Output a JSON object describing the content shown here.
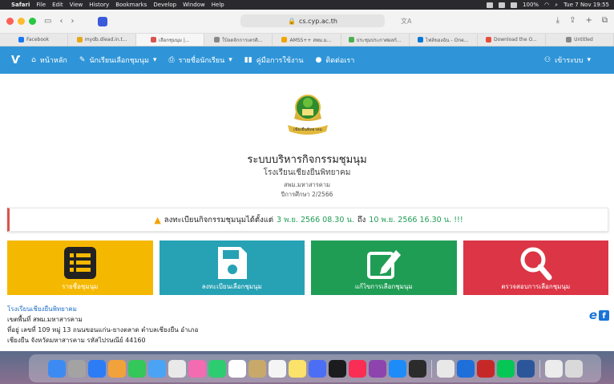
{
  "menubar": {
    "app": "Safari",
    "menus": [
      "File",
      "Edit",
      "View",
      "History",
      "Bookmarks",
      "Develop",
      "Window",
      "Help"
    ],
    "battery": "100%",
    "clock": "Tue 7 Nov 19:55"
  },
  "browser": {
    "url": "cs.cyp.ac.th",
    "tabs": [
      "Facebook",
      "mydb.dlead.in.t...",
      "เลือกชุมนุม |...",
      "ใบ้จดจักการเครดิ...",
      "AMSS++ สพม.ม...",
      "ประชุมประกาศผลกั...",
      "ไฟล์ของฉัน - One...",
      "Download the O...",
      "Untitled"
    ],
    "tab_colors": [
      "#1877f2",
      "#e6a817",
      "#d9534f",
      "#888888",
      "#f0a500",
      "#4caf50",
      "#0078d4",
      "#e74c3c",
      "#888888"
    ]
  },
  "nav": {
    "home": "หน้าหลัก",
    "students_clubs": "นักเรียนเลือกชุมนุม",
    "student_list": "รายชื่อนักเรียน",
    "manual": "คู่มือการใช้งาน",
    "contact": "ติดต่อเรา",
    "login": "เข้าระบบ"
  },
  "hero": {
    "emblem_text": "เชียงยืนพิทยาคม",
    "title": "ระบบบริหารกิจกรรมชุมนุม",
    "subtitle": "โรงเรียนเชียงยืนพิทยาคม",
    "area": "สพม.มหาสารคาม",
    "term": "ปีการศึกษา 2/2566"
  },
  "alert": {
    "prefix": "ลงทะเบียนกิจกรรมชุมนุมได้ตั้งแต่",
    "start": "3 พ.ย. 2566 08.30 น.",
    "mid": "ถึง",
    "end": "10 พ.ย. 2566 16.30 น. !!!"
  },
  "tiles": [
    {
      "label": "รายชื่อชุมนุม",
      "color": "#f5b800"
    },
    {
      "label": "ลงทะเบียนเลือกชุมนุม",
      "color": "#27a2b5"
    },
    {
      "label": "แก้ไขการเลือกชุมนุม",
      "color": "#1f9d55"
    },
    {
      "label": "ตรวจสอบการเลือกชุมนุม",
      "color": "#dc3545"
    }
  ],
  "footer": {
    "school": "โรงเรียนเชียงยืนพิทยาคม",
    "area": "เขตพื้นที่ สพม.มหาสารคาม",
    "address1": "ที่อยู่ เลขที่ 109 หมู่ 13 ถนนขอนแก่น-ยางตลาด ตำบลเชียงยืน อำเภอ",
    "address2": "เชียงยืน จังหวัดมหาสารคาม รหัสไปรษณีย์ 44160"
  }
}
